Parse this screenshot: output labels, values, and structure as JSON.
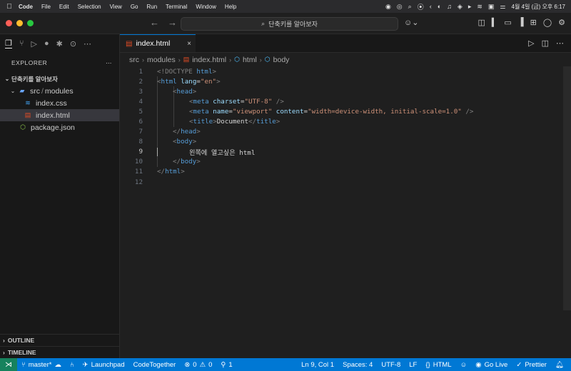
{
  "menubar": {
    "app": "Code",
    "items": [
      "File",
      "Edit",
      "Selection",
      "View",
      "Go",
      "Run",
      "Terminal",
      "Window",
      "Help"
    ],
    "clock": "4월 4일 (금) 오후 6:17"
  },
  "titlebar": {
    "search_text": "단축키를 알아보자"
  },
  "sidebar": {
    "header": "EXPLORER",
    "root": "단축키를 알아보자",
    "folder": "src",
    "subfolder": "modules",
    "files": [
      {
        "name": "index.css",
        "icon": "css-file-icon",
        "color": "#42a5f5"
      },
      {
        "name": "index.html",
        "icon": "html-file-icon",
        "color": "#e44d26"
      }
    ],
    "package": "package.json",
    "outline": "OUTLINE",
    "timeline": "TIMELINE"
  },
  "editor": {
    "tab_label": "index.html",
    "breadcrumb": [
      "src",
      "modules",
      "index.html",
      "html",
      "body"
    ],
    "lines": [
      "1",
      "2",
      "3",
      "4",
      "5",
      "6",
      "7",
      "8",
      "9",
      "10",
      "11",
      "12"
    ],
    "code": {
      "l1_kw": "<!DOCTYPE",
      "l1_tag": "html",
      "l2_tag": "html",
      "l2_attr": "lang",
      "l2_val": "\"en\"",
      "l3_tag": "head",
      "l4_tag": "meta",
      "l4_attr": "charset",
      "l4_val": "\"UTF-8\"",
      "l5_tag": "meta",
      "l5_attr1": "name",
      "l5_val1": "\"viewport\"",
      "l5_attr2": "content",
      "l5_val2": "\"width=device-width, initial-scale=1.0\"",
      "l6_tag": "title",
      "l6_text": "Document",
      "l7_tag": "head",
      "l8_tag": "body",
      "l9_text": "왼쪽에 열고싶은 html",
      "l10_tag": "body",
      "l11_tag": "html"
    }
  },
  "statusbar": {
    "branch": "master*",
    "launchpad": "Launchpad",
    "codetogether": "CodeTogether",
    "errors": "0",
    "warnings": "0",
    "ports": "1",
    "position": "Ln 9, Col 1",
    "spaces": "Spaces: 4",
    "encoding": "UTF-8",
    "eol": "LF",
    "language": "HTML",
    "golive": "Go Live",
    "prettier": "Prettier"
  },
  "colors": {
    "accent": "#0078d4",
    "remote": "#16825d",
    "red": "#ff5f57",
    "yellow": "#febc2e",
    "green": "#28c840"
  }
}
